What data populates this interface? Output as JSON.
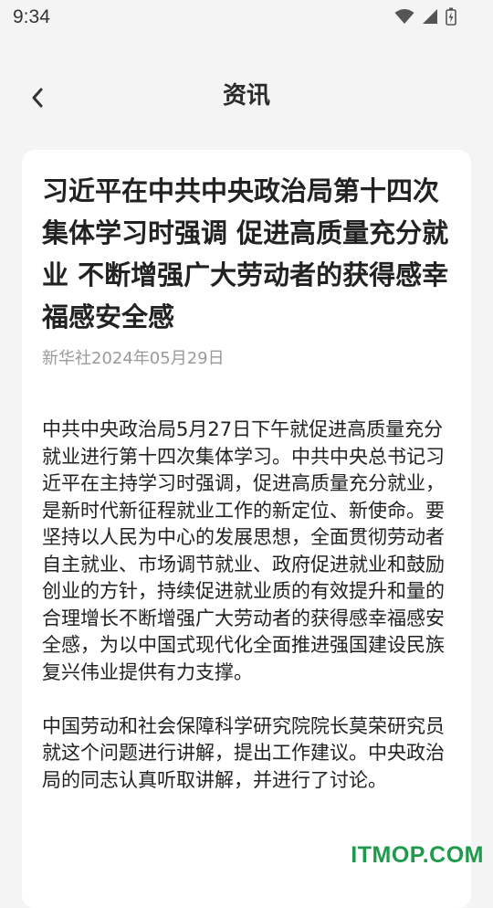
{
  "status_bar": {
    "time": "9:34",
    "icons": [
      "wifi-icon",
      "signal-icon",
      "battery-icon"
    ]
  },
  "nav": {
    "back_icon": "chevron-left-icon",
    "title": "资讯"
  },
  "article": {
    "title": "习近平在中共中央政治局第十四次集体学习时强调 促进高质量充分就业 不断增强广大劳动者的获得感幸福感安全感",
    "source": "新华社",
    "date": "2024年05月29日",
    "paragraphs": [
      "中共中央政治局5月27日下午就促进高质量充分就业进行第十四次集体学习。中共中央总书记习近平在主持学习时强调，促进高质量充分就业，是新时代新征程就业工作的新定位、新使命。要坚持以人民为中心的发展思想，全面贯彻劳动者自主就业、市场调节就业、政府促进就业和鼓励创业的方针，持续促进就业质的有效提升和量的合理增长不断增强广大劳动者的获得感幸福感安全感，为以中国式现代化全面推进强国建设民族复兴伟业提供有力支撑。",
      "中国劳动和社会保障科学研究院院长莫荣研究员就这个问题进行讲解，提出工作建议。中央政治局的同志认真听取讲解，并进行了讨论。"
    ]
  },
  "watermark": "ITMOP.COM",
  "colors": {
    "background": "#f4f4f4",
    "card": "#ffffff",
    "meta_text": "#9a9a9a",
    "watermark": "#1f9a4c"
  }
}
